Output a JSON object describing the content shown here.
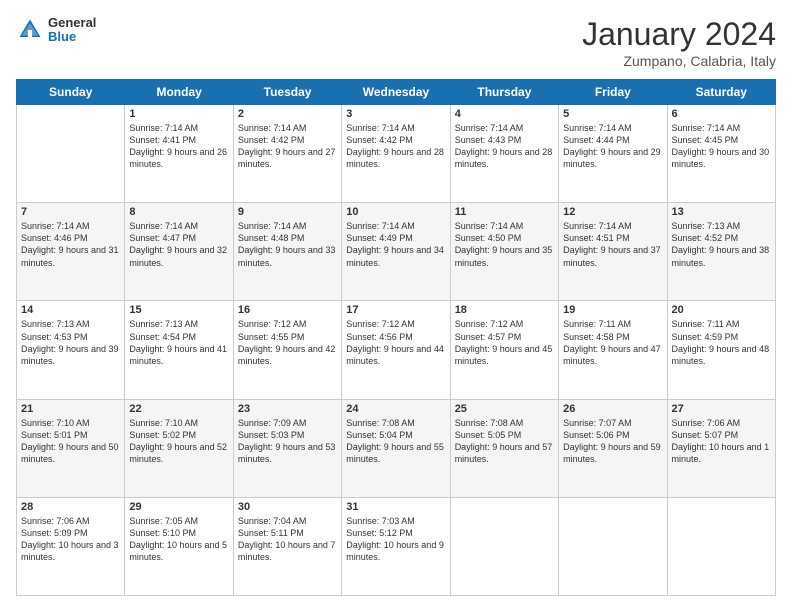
{
  "header": {
    "logo": {
      "part1": "General",
      "part2": "Blue"
    },
    "title": "January 2024",
    "location": "Zumpano, Calabria, Italy"
  },
  "weekdays": [
    "Sunday",
    "Monday",
    "Tuesday",
    "Wednesday",
    "Thursday",
    "Friday",
    "Saturday"
  ],
  "weeks": [
    [
      {
        "day": "",
        "sunrise": "",
        "sunset": "",
        "daylight": ""
      },
      {
        "day": "1",
        "sunrise": "Sunrise: 7:14 AM",
        "sunset": "Sunset: 4:41 PM",
        "daylight": "Daylight: 9 hours and 26 minutes."
      },
      {
        "day": "2",
        "sunrise": "Sunrise: 7:14 AM",
        "sunset": "Sunset: 4:42 PM",
        "daylight": "Daylight: 9 hours and 27 minutes."
      },
      {
        "day": "3",
        "sunrise": "Sunrise: 7:14 AM",
        "sunset": "Sunset: 4:42 PM",
        "daylight": "Daylight: 9 hours and 28 minutes."
      },
      {
        "day": "4",
        "sunrise": "Sunrise: 7:14 AM",
        "sunset": "Sunset: 4:43 PM",
        "daylight": "Daylight: 9 hours and 28 minutes."
      },
      {
        "day": "5",
        "sunrise": "Sunrise: 7:14 AM",
        "sunset": "Sunset: 4:44 PM",
        "daylight": "Daylight: 9 hours and 29 minutes."
      },
      {
        "day": "6",
        "sunrise": "Sunrise: 7:14 AM",
        "sunset": "Sunset: 4:45 PM",
        "daylight": "Daylight: 9 hours and 30 minutes."
      }
    ],
    [
      {
        "day": "7",
        "sunrise": "Sunrise: 7:14 AM",
        "sunset": "Sunset: 4:46 PM",
        "daylight": "Daylight: 9 hours and 31 minutes."
      },
      {
        "day": "8",
        "sunrise": "Sunrise: 7:14 AM",
        "sunset": "Sunset: 4:47 PM",
        "daylight": "Daylight: 9 hours and 32 minutes."
      },
      {
        "day": "9",
        "sunrise": "Sunrise: 7:14 AM",
        "sunset": "Sunset: 4:48 PM",
        "daylight": "Daylight: 9 hours and 33 minutes."
      },
      {
        "day": "10",
        "sunrise": "Sunrise: 7:14 AM",
        "sunset": "Sunset: 4:49 PM",
        "daylight": "Daylight: 9 hours and 34 minutes."
      },
      {
        "day": "11",
        "sunrise": "Sunrise: 7:14 AM",
        "sunset": "Sunset: 4:50 PM",
        "daylight": "Daylight: 9 hours and 35 minutes."
      },
      {
        "day": "12",
        "sunrise": "Sunrise: 7:14 AM",
        "sunset": "Sunset: 4:51 PM",
        "daylight": "Daylight: 9 hours and 37 minutes."
      },
      {
        "day": "13",
        "sunrise": "Sunrise: 7:13 AM",
        "sunset": "Sunset: 4:52 PM",
        "daylight": "Daylight: 9 hours and 38 minutes."
      }
    ],
    [
      {
        "day": "14",
        "sunrise": "Sunrise: 7:13 AM",
        "sunset": "Sunset: 4:53 PM",
        "daylight": "Daylight: 9 hours and 39 minutes."
      },
      {
        "day": "15",
        "sunrise": "Sunrise: 7:13 AM",
        "sunset": "Sunset: 4:54 PM",
        "daylight": "Daylight: 9 hours and 41 minutes."
      },
      {
        "day": "16",
        "sunrise": "Sunrise: 7:12 AM",
        "sunset": "Sunset: 4:55 PM",
        "daylight": "Daylight: 9 hours and 42 minutes."
      },
      {
        "day": "17",
        "sunrise": "Sunrise: 7:12 AM",
        "sunset": "Sunset: 4:56 PM",
        "daylight": "Daylight: 9 hours and 44 minutes."
      },
      {
        "day": "18",
        "sunrise": "Sunrise: 7:12 AM",
        "sunset": "Sunset: 4:57 PM",
        "daylight": "Daylight: 9 hours and 45 minutes."
      },
      {
        "day": "19",
        "sunrise": "Sunrise: 7:11 AM",
        "sunset": "Sunset: 4:58 PM",
        "daylight": "Daylight: 9 hours and 47 minutes."
      },
      {
        "day": "20",
        "sunrise": "Sunrise: 7:11 AM",
        "sunset": "Sunset: 4:59 PM",
        "daylight": "Daylight: 9 hours and 48 minutes."
      }
    ],
    [
      {
        "day": "21",
        "sunrise": "Sunrise: 7:10 AM",
        "sunset": "Sunset: 5:01 PM",
        "daylight": "Daylight: 9 hours and 50 minutes."
      },
      {
        "day": "22",
        "sunrise": "Sunrise: 7:10 AM",
        "sunset": "Sunset: 5:02 PM",
        "daylight": "Daylight: 9 hours and 52 minutes."
      },
      {
        "day": "23",
        "sunrise": "Sunrise: 7:09 AM",
        "sunset": "Sunset: 5:03 PM",
        "daylight": "Daylight: 9 hours and 53 minutes."
      },
      {
        "day": "24",
        "sunrise": "Sunrise: 7:08 AM",
        "sunset": "Sunset: 5:04 PM",
        "daylight": "Daylight: 9 hours and 55 minutes."
      },
      {
        "day": "25",
        "sunrise": "Sunrise: 7:08 AM",
        "sunset": "Sunset: 5:05 PM",
        "daylight": "Daylight: 9 hours and 57 minutes."
      },
      {
        "day": "26",
        "sunrise": "Sunrise: 7:07 AM",
        "sunset": "Sunset: 5:06 PM",
        "daylight": "Daylight: 9 hours and 59 minutes."
      },
      {
        "day": "27",
        "sunrise": "Sunrise: 7:06 AM",
        "sunset": "Sunset: 5:07 PM",
        "daylight": "Daylight: 10 hours and 1 minute."
      }
    ],
    [
      {
        "day": "28",
        "sunrise": "Sunrise: 7:06 AM",
        "sunset": "Sunset: 5:09 PM",
        "daylight": "Daylight: 10 hours and 3 minutes."
      },
      {
        "day": "29",
        "sunrise": "Sunrise: 7:05 AM",
        "sunset": "Sunset: 5:10 PM",
        "daylight": "Daylight: 10 hours and 5 minutes."
      },
      {
        "day": "30",
        "sunrise": "Sunrise: 7:04 AM",
        "sunset": "Sunset: 5:11 PM",
        "daylight": "Daylight: 10 hours and 7 minutes."
      },
      {
        "day": "31",
        "sunrise": "Sunrise: 7:03 AM",
        "sunset": "Sunset: 5:12 PM",
        "daylight": "Daylight: 10 hours and 9 minutes."
      },
      {
        "day": "",
        "sunrise": "",
        "sunset": "",
        "daylight": ""
      },
      {
        "day": "",
        "sunrise": "",
        "sunset": "",
        "daylight": ""
      },
      {
        "day": "",
        "sunrise": "",
        "sunset": "",
        "daylight": ""
      }
    ]
  ]
}
